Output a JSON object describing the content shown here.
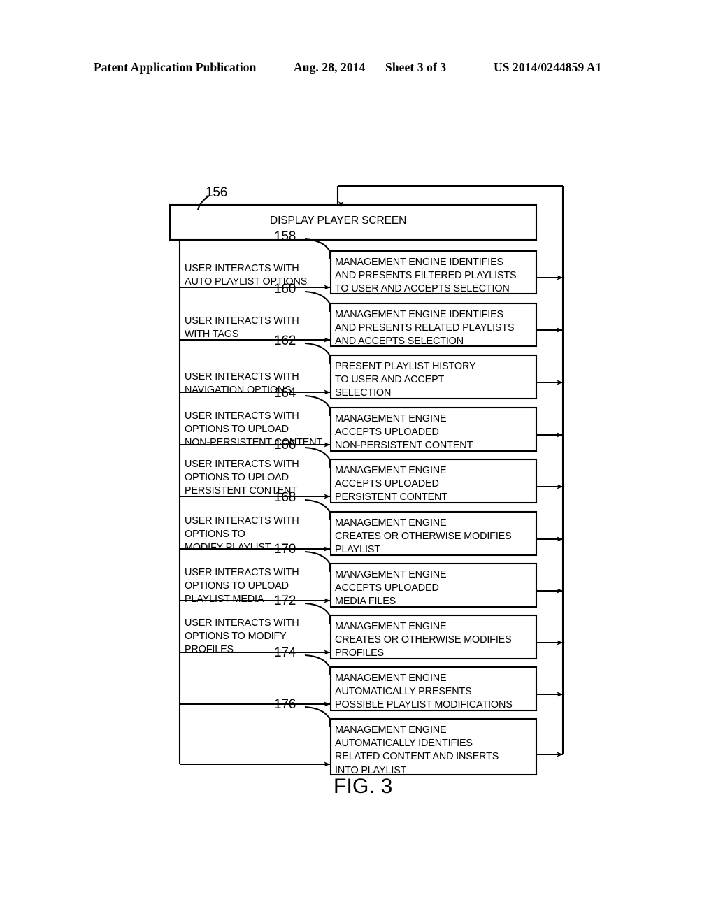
{
  "header": {
    "left": "Patent Application Publication",
    "date": "Aug. 28, 2014",
    "sheet": "Sheet 3 of 3",
    "number": "US 2014/0244859 A1"
  },
  "figure": {
    "caption": "FIG. 3",
    "top_block": {
      "ref": "156",
      "label": "DISPLAY PLAYER SCREEN"
    },
    "rows": [
      {
        "ref": "158",
        "left_lines": [
          "USER INTERACTS WITH",
          "AUTO PLAYLIST OPTIONS"
        ],
        "right_lines": [
          "MANAGEMENT ENGINE IDENTIFIES",
          "AND PRESENTS FILTERED PLAYLISTS",
          "TO USER AND ACCEPTS SELECTION"
        ]
      },
      {
        "ref": "160",
        "left_lines": [
          "USER INTERACTS WITH",
          "WITH TAGS"
        ],
        "right_lines": [
          "MANAGEMENT ENGINE IDENTIFIES",
          "AND PRESENTS RELATED PLAYLISTS",
          "AND ACCEPTS SELECTION"
        ]
      },
      {
        "ref": "162",
        "left_lines": [
          "USER INTERACTS WITH",
          "NAVIGATION OPTIONS"
        ],
        "right_lines": [
          "PRESENT PLAYLIST HISTORY",
          "TO USER AND ACCEPT",
          "SELECTION"
        ]
      },
      {
        "ref": "164",
        "left_lines": [
          "USER INTERACTS WITH",
          "OPTIONS TO UPLOAD",
          "NON-PERSISTENT CONTENT"
        ],
        "right_lines": [
          "MANAGEMENT ENGINE",
          "ACCEPTS UPLOADED",
          "NON-PERSISTENT CONTENT"
        ]
      },
      {
        "ref": "166",
        "left_lines": [
          "USER INTERACTS WITH",
          "OPTIONS TO UPLOAD",
          "PERSISTENT CONTENT"
        ],
        "right_lines": [
          "MANAGEMENT ENGINE",
          "ACCEPTS UPLOADED",
          "PERSISTENT CONTENT"
        ]
      },
      {
        "ref": "168",
        "left_lines": [
          "USER INTERACTS WITH",
          "OPTIONS TO",
          "MODIFY PLAYLIST"
        ],
        "right_lines": [
          "MANAGEMENT ENGINE",
          "CREATES OR OTHERWISE MODIFIES",
          "PLAYLIST"
        ]
      },
      {
        "ref": "170",
        "left_lines": [
          "USER INTERACTS WITH",
          "OPTIONS TO UPLOAD",
          "PLAYLIST MEDIA"
        ],
        "right_lines": [
          "MANAGEMENT ENGINE",
          "ACCEPTS UPLOADED",
          "MEDIA FILES"
        ]
      },
      {
        "ref": "172",
        "left_lines": [
          "USER INTERACTS WITH",
          "OPTIONS TO MODIFY",
          "PROFILES"
        ],
        "right_lines": [
          "MANAGEMENT ENGINE",
          "CREATES OR OTHERWISE MODIFIES",
          "PROFILES"
        ]
      },
      {
        "ref": "174",
        "left_lines": [],
        "right_lines": [
          "MANAGEMENT ENGINE",
          "AUTOMATICALLY PRESENTS",
          "POSSIBLE PLAYLIST MODIFICATIONS"
        ]
      },
      {
        "ref": "176",
        "left_lines": [],
        "right_lines": [
          "MANAGEMENT ENGINE",
          "AUTOMATICALLY IDENTIFIES",
          "RELATED CONTENT AND INSERTS",
          "INTO PLAYLIST"
        ]
      }
    ]
  }
}
